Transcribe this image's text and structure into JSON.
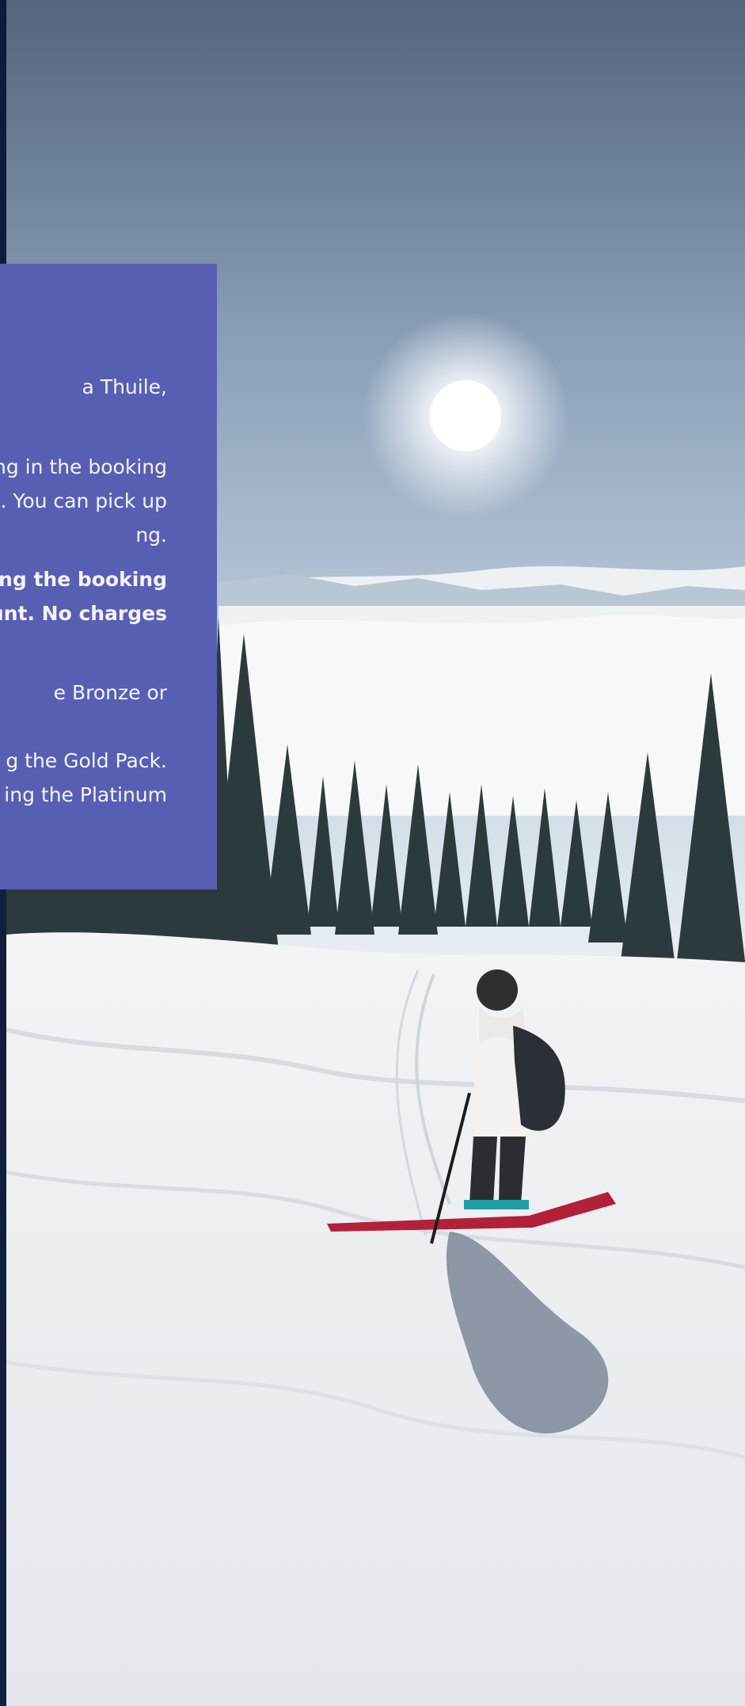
{
  "info": {
    "line_1": "a Thuile,",
    "line_2": "ng in the booking",
    "line_3": "e. You can pick up",
    "line_4": "ng.",
    "line_5": "ring the booking",
    "line_6": "ount. No charges",
    "line_7": "e Bronze or",
    "line_8": "g the Gold Pack.",
    "line_9": "ing the Platinum"
  },
  "colors": {
    "panel": "#585fb3",
    "text": "#f3f4ff",
    "rail": "#0d1b3a"
  },
  "image": {
    "subject": "skier-on-snowy-slope-photo"
  }
}
